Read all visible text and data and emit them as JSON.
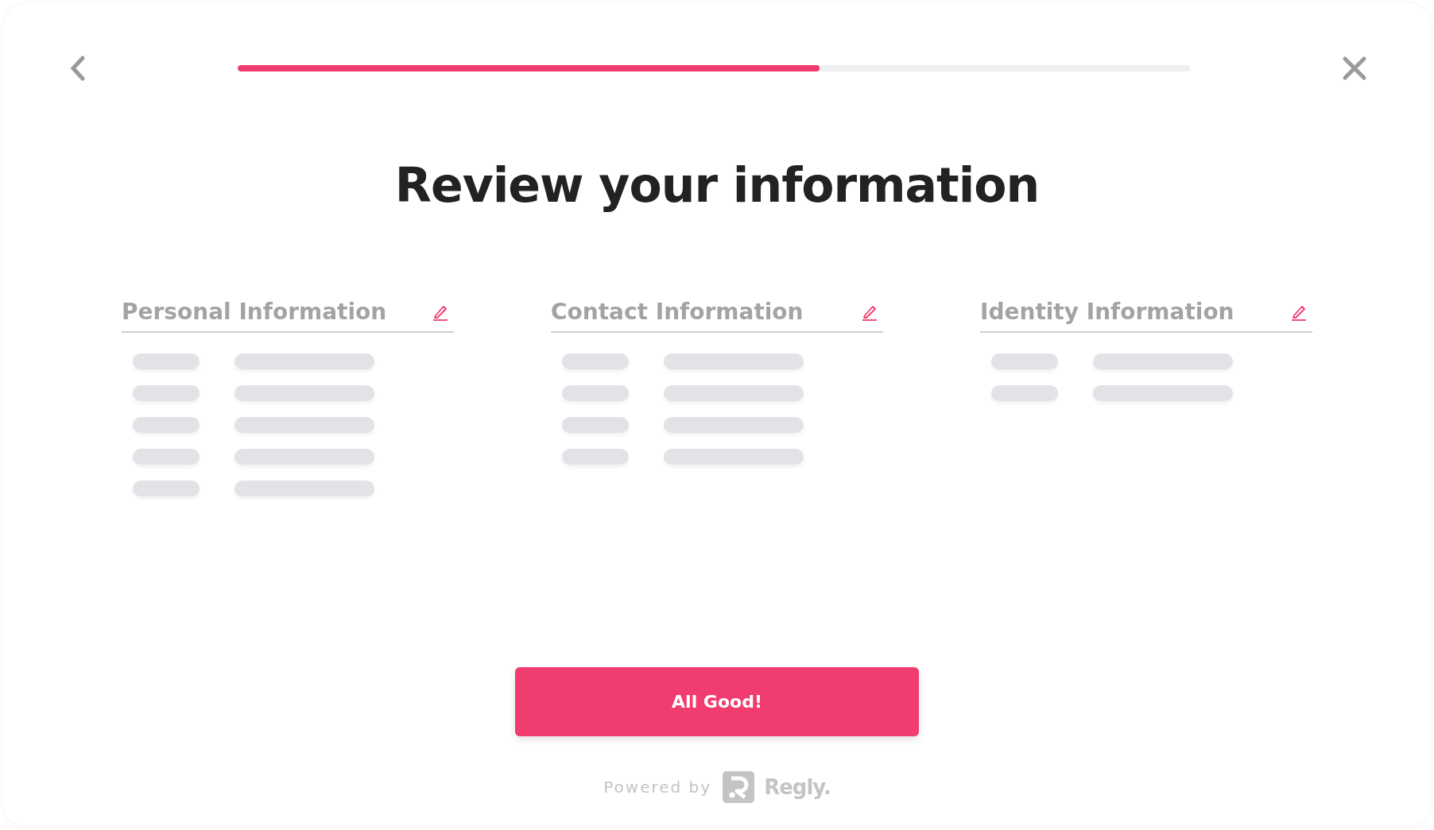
{
  "progress": {
    "level": 0.611
  },
  "title": "Review your information",
  "sections": [
    {
      "heading": "Personal Information",
      "rows": [
        {
          "kind": "skeleton"
        },
        {
          "kind": "skeleton"
        },
        {
          "kind": "skeleton"
        },
        {
          "kind": "skeleton"
        },
        {
          "kind": "skeleton"
        }
      ]
    },
    {
      "heading": "Contact Information",
      "rows": [
        {
          "kind": "skeleton"
        },
        {
          "kind": "skeleton"
        },
        {
          "kind": "skeleton"
        },
        {
          "kind": "skeleton"
        }
      ]
    },
    {
      "heading": "Identity Information",
      "rows": [
        {
          "kind": "skeleton"
        },
        {
          "kind": "skeleton"
        }
      ]
    }
  ],
  "primary_button": "All Good!",
  "footer": {
    "prefix": "Powered by",
    "brand": "Regly."
  }
}
